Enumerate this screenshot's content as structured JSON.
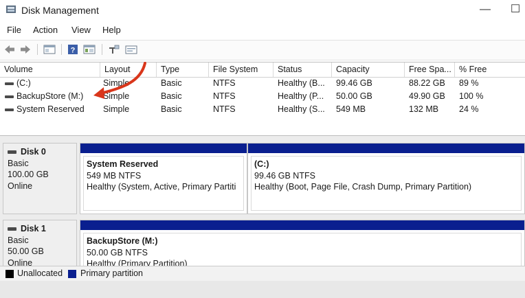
{
  "window": {
    "title": "Disk Management",
    "minimize": "—",
    "maximize": "☐"
  },
  "menu": [
    "File",
    "Action",
    "View",
    "Help"
  ],
  "toolbar_icons": [
    "back-arrow-icon",
    "forward-arrow-icon",
    "properties-icon",
    "help-icon",
    "console-tree-icon",
    "rescan-icon",
    "disk-list-icon"
  ],
  "columns": [
    "Volume",
    "Layout",
    "Type",
    "File System",
    "Status",
    "Capacity",
    "Free Spa...",
    "% Free"
  ],
  "volumes": [
    {
      "volume": "(C:)",
      "layout": "Simple",
      "type": "Basic",
      "fs": "NTFS",
      "status": "Healthy (B...",
      "capacity": "99.46 GB",
      "free": "88.22 GB",
      "pct": "89 %"
    },
    {
      "volume": "BackupStore (M:)",
      "layout": "Simple",
      "type": "Basic",
      "fs": "NTFS",
      "status": "Healthy (P...",
      "capacity": "50.00 GB",
      "free": "49.90 GB",
      "pct": "100 %"
    },
    {
      "volume": "System Reserved",
      "layout": "Simple",
      "type": "Basic",
      "fs": "NTFS",
      "status": "Healthy (S...",
      "capacity": "549 MB",
      "free": "132 MB",
      "pct": "24 %"
    }
  ],
  "disks": [
    {
      "name": "Disk 0",
      "type": "Basic",
      "size": "100.00 GB",
      "state": "Online",
      "partitions": [
        {
          "name": "System Reserved",
          "size": "549 MB NTFS",
          "status": "Healthy (System, Active, Primary Partiti"
        },
        {
          "name": "(C:)",
          "size": "99.46 GB NTFS",
          "status": "Healthy (Boot, Page File, Crash Dump, Primary Partition)"
        }
      ]
    },
    {
      "name": "Disk 1",
      "type": "Basic",
      "size": "50.00 GB",
      "state": "Online",
      "partitions": [
        {
          "name": "BackupStore  (M:)",
          "size": "50.00 GB NTFS",
          "status": "Healthy (Primary Partition)"
        }
      ]
    }
  ],
  "legend": [
    {
      "label": "Unallocated",
      "color": "#000000"
    },
    {
      "label": "Primary partition",
      "color": "#0a1f8f"
    }
  ],
  "colors": {
    "primary_partition": "#0a1f8f",
    "annotation_arrow": "#d9361b"
  }
}
